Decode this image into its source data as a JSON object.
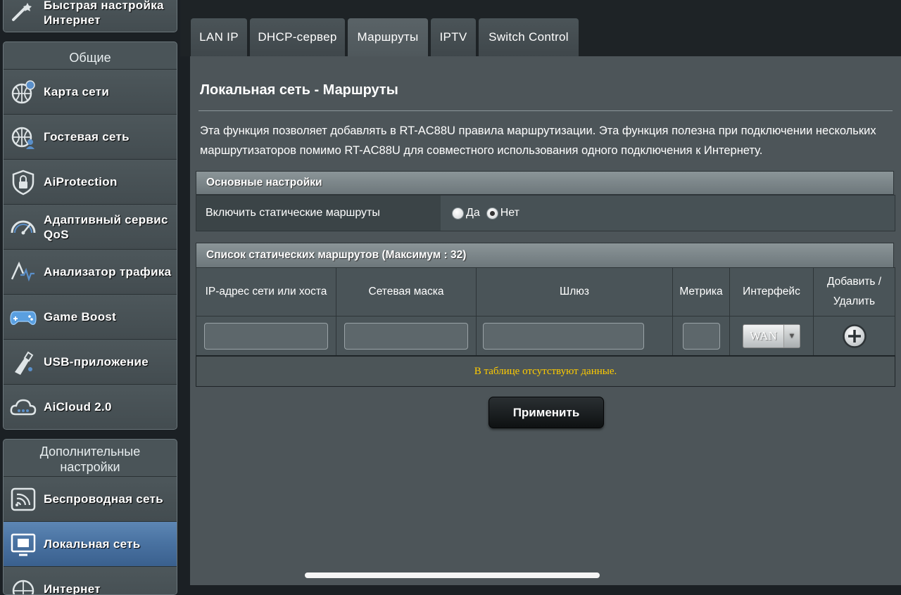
{
  "sidebar": {
    "quick_setup_label": "Быстрая настройка\nИнтернет",
    "general": {
      "header": "Общие",
      "items": [
        {
          "label": "Карта сети",
          "icon": "network-map-icon"
        },
        {
          "label": "Гостевая сеть",
          "icon": "guest-network-icon"
        },
        {
          "label": "AiProtection",
          "icon": "aiprotection-shield-icon"
        },
        {
          "label": "Адаптивный сервис QoS",
          "icon": "qos-gauge-icon"
        },
        {
          "label": "Анализатор трафика",
          "icon": "traffic-analyzer-icon"
        },
        {
          "label": "Game Boost",
          "icon": "gamepad-icon"
        },
        {
          "label": "USB-приложение",
          "icon": "usb-icon"
        },
        {
          "label": "AiCloud 2.0",
          "icon": "cloud-icon"
        }
      ]
    },
    "advanced": {
      "header": "Дополнительные настройки",
      "items": [
        {
          "label": "Беспроводная сеть",
          "icon": "wireless-icon"
        },
        {
          "label": "Локальная сеть",
          "icon": "lan-monitor-icon",
          "active": true
        },
        {
          "label": "Интернет",
          "icon": "globe-icon"
        }
      ]
    }
  },
  "tabs": [
    {
      "label": "LAN IP"
    },
    {
      "label": "DHCP-сервер"
    },
    {
      "label": "Маршруты",
      "active": true
    },
    {
      "label": "IPTV"
    },
    {
      "label": "Switch Control"
    }
  ],
  "page": {
    "title": "Локальная сеть - Маршруты",
    "description": "Эта функция позволяет добавлять в RT-AC88U правила маршрутизации. Эта функция полезна при подключении нескольких маршрутизаторов помимо RT-AC88U для совместного использования одного подключения к Интернету."
  },
  "basic_settings": {
    "header": "Основные настройки",
    "enable_static_label": "Включить статические маршруты",
    "option_yes": "Да",
    "option_no": "Нет",
    "selected": "Нет"
  },
  "routes_list": {
    "header": "Список статических маршрутов (Максимум : 32)",
    "columns": {
      "ip": "IP-адрес сети или хоста",
      "mask": "Сетевая маска",
      "gateway": "Шлюз",
      "metric": "Метрика",
      "interface": "Интерфейс",
      "add_delete": "Добавить / Удалить"
    },
    "input": {
      "ip": "",
      "mask": "",
      "gateway": "",
      "metric": "",
      "interface": "WAN"
    },
    "empty_message": "В таблице отсутствуют данные."
  },
  "apply_button": "Применить",
  "colors": {
    "active_nav": "#4a73a2",
    "empty_text": "#ffcc00",
    "panel_bg": "#4d5559"
  }
}
